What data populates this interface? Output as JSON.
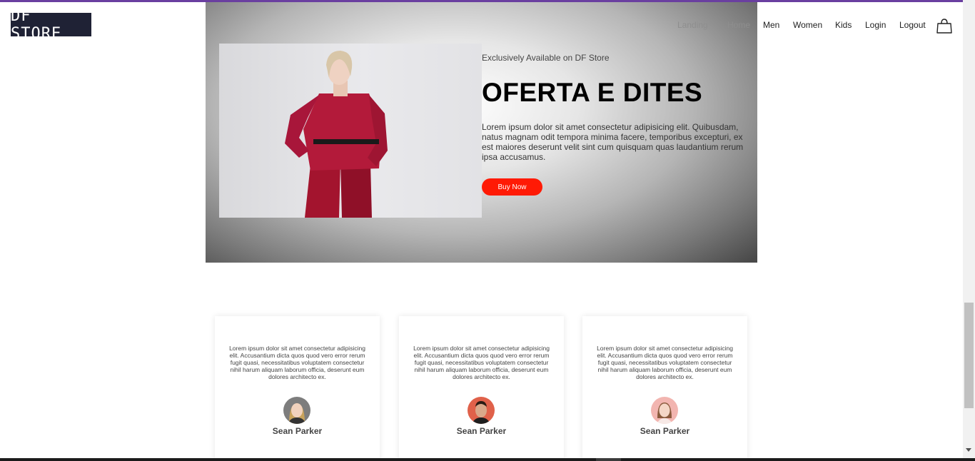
{
  "brand": {
    "logo_text": "DF STORE",
    "accent_color": "#6a3fa0",
    "buy_color": "#ff1a05"
  },
  "nav": {
    "items": [
      {
        "label": "Landing"
      },
      {
        "label": "Home"
      },
      {
        "label": "Men"
      },
      {
        "label": "Women"
      },
      {
        "label": "Kids"
      },
      {
        "label": "Login"
      },
      {
        "label": "Logout"
      }
    ],
    "cart_icon": "shopping-bag-icon"
  },
  "hero": {
    "subtitle": "Exclusively Available on DF Store",
    "title": "OFERTA E DITES",
    "description": "Lorem ipsum dolor sit amet consectetur adipisicing elit. Quibusdam, natus magnam odit tempora minima facere, temporibus excepturi, ex est maiores deserunt velit sint cum quisquam quas laudantium rerum ipsa accusamus.",
    "button_label": "Buy Now"
  },
  "testimonials": [
    {
      "text": "Lorem ipsum dolor sit amet consectetur adipisicing elit. Accusantium dicta quos quod vero error rerum fugit quasi, necessitatibus voluptatem consectetur nihil harum aliquam laborum officia, deserunt eum dolores architecto ex.",
      "name": "Sean Parker"
    },
    {
      "text": "Lorem ipsum dolor sit amet consectetur adipisicing elit. Accusantium dicta quos quod vero error rerum fugit quasi, necessitatibus voluptatem consectetur nihil harum aliquam laborum officia, deserunt eum dolores architecto ex.",
      "name": "Sean Parker"
    },
    {
      "text": "Lorem ipsum dolor sit amet consectetur adipisicing elit. Accusantium dicta quos quod vero error rerum fugit quasi, necessitatibus voluptatem consectetur nihil harum aliquam laborum officia, deserunt eum dolores architecto ex.",
      "name": "Sean Parker"
    }
  ]
}
